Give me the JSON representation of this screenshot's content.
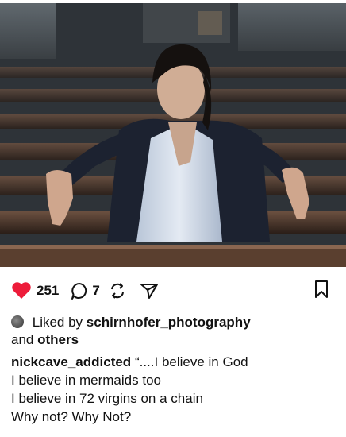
{
  "post": {
    "likes_count": "251",
    "comments_count": "7",
    "liked_by_prefix": "Liked by",
    "liked_by_user": "schirnhofer_photography",
    "liked_by_and": "and",
    "liked_by_others": "others",
    "caption_user": "nickcave_addicted",
    "caption_lines": [
      "“....I believe in God",
      "I believe in mermaids too",
      "I believe in 72 virgins on a chain",
      "Why not? Why Not?"
    ]
  },
  "icons": {
    "like": "heart-icon",
    "comment": "comment-icon",
    "repost": "repost-icon",
    "share": "share-icon",
    "save": "bookmark-icon"
  },
  "colors": {
    "like_active": "#ed1c3a",
    "text": "#111111"
  }
}
